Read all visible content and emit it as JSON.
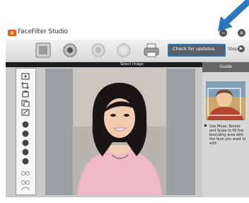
{
  "window": {
    "title": "FaceFilter Studio"
  },
  "toolbar": {
    "update_label": "Check for updates",
    "step_label": "Step"
  },
  "header": {
    "section_label": "Select Image"
  },
  "guide": {
    "title": "Guide",
    "text": "Use Move, Rotate and Scale to fill the bounding area with the face you want to edit."
  },
  "colors": {
    "accent_blue": "#2377bd",
    "highlight_border": "#2377bd"
  }
}
